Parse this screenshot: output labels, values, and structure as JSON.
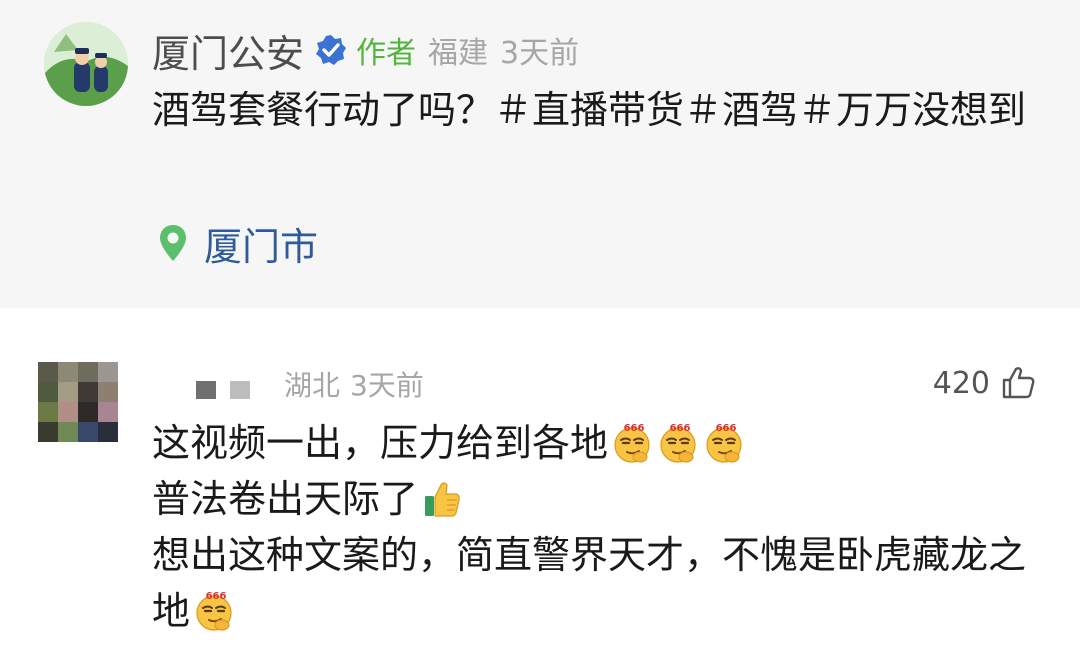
{
  "post": {
    "author": "厦门公安",
    "author_tag": "作者",
    "region": "福建",
    "time": "3天前",
    "text": "酒驾套餐行动了吗？＃直播带货＃酒驾＃万万没想到",
    "location": "厦门市"
  },
  "comment": {
    "region": "湖北",
    "time": "3天前",
    "likes": "420",
    "lines": [
      "这视频一出，压力给到各地",
      "普法卷出天际了",
      "想出这种文案的，简直警界天才，不愧是卧虎藏龙之地"
    ]
  },
  "emoji": {
    "sneer_label": "666"
  },
  "icons": {
    "verified": "verified-badge-icon",
    "location": "location-pin-icon",
    "like": "thumbs-up-outline-icon",
    "emoji_666": "smug-666-emoji-icon",
    "emoji_thumbs": "thumbs-up-emoji-icon"
  },
  "colors": {
    "post_background": "#f6f6f6",
    "author_tag": "#52b43c",
    "location_text": "#2f5b9c",
    "verified_badge": "#3b73d4",
    "location_pin": "#5bbf6c",
    "meta_text": "#a6a6a6"
  }
}
